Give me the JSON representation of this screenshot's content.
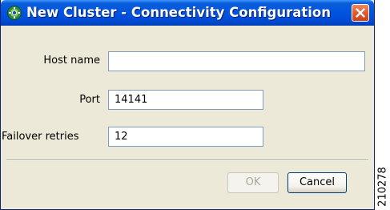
{
  "window": {
    "title": "New Cluster - Connectivity Configuration",
    "app_icon": "cluster-gear-icon",
    "close_icon": "close-icon"
  },
  "form": {
    "host_name": {
      "label": "Host name",
      "value": ""
    },
    "port": {
      "label": "Port",
      "value": "14141"
    },
    "failover_retries": {
      "label": "Failover retries",
      "value": "12"
    }
  },
  "buttons": {
    "ok": {
      "label": "OK",
      "enabled": false
    },
    "cancel": {
      "label": "Cancel",
      "enabled": true
    }
  },
  "figure_id": "210278",
  "colors": {
    "titlebar": "#0053e1",
    "window_background": "#ece9d8",
    "close_button": "#e25b2d",
    "field_border": "#7f9db9"
  }
}
